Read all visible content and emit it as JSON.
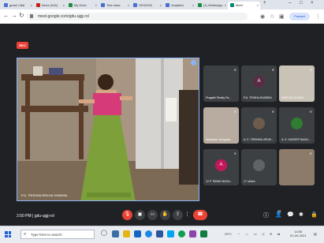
{
  "browser": {
    "tabs": [
      {
        "label": "gmail | Mai",
        "color": "#4a6fd3"
      },
      {
        "label": "Inbox (542)",
        "color": "#c5221f"
      },
      {
        "label": "My Drive",
        "color": "#1e8e3e"
      },
      {
        "label": "Test class",
        "color": "#4a6fd3"
      },
      {
        "label": "GE02004",
        "color": "#4a6fd3"
      },
      {
        "label": "Analytics",
        "color": "#4a6fd3"
      },
      {
        "label": "(1) WhatsApp",
        "color": "#1e8e3e"
      },
      {
        "label": "Meet",
        "color": "#00897b"
      }
    ],
    "new_tab": "+",
    "address": "meet.google.com/gdu-ujgj-rol",
    "paused_label": "Paused"
  },
  "meet": {
    "rec_label": "REC",
    "main_participant": "P.A. TRISHNA REKHA SHARMA",
    "tiles": [
      {
        "name": "Pragathi Reddy Pa...",
        "initial": "",
        "color": "#3c4043"
      },
      {
        "name": "P.A. TRISHA SHARMA",
        "initial": "A",
        "color": "#5b2b45"
      },
      {
        "name": "NASHITA SHAIKH",
        "initial": "",
        "color": "#c9c2b6"
      },
      {
        "name": "Maitreyee Sengupta",
        "initial": "",
        "color": "#b8aba0"
      },
      {
        "name": "A. E. TRISHNA VEDIK...",
        "initial": "",
        "color": "#3c4043"
      },
      {
        "name": "A. E. SUDEEP NAGA...",
        "initial": "",
        "color": "#3c4043"
      },
      {
        "name": "12 P. PAVAN NAGA...",
        "initial": "A",
        "color": "#c2185b"
      },
      {
        "name": "17 others",
        "initial": "",
        "color": "#3c4043"
      },
      {
        "name": "",
        "initial": "",
        "color": "#8c7a6b"
      }
    ],
    "time_meeting": "2:50 PM  |  gdu-ujgj-rol",
    "people_count": "25",
    "icons": {
      "mic": "mic-icon",
      "cam": "camera-icon",
      "cc": "captions-icon",
      "present": "present-icon",
      "hand": "raise-hand-icon",
      "more": "more-options-icon",
      "end": "end-call-icon"
    }
  },
  "taskbar": {
    "search_placeholder": "Type here to search",
    "temperature": "29°C",
    "clock_time": "14:50",
    "clock_date": "01-09-2021"
  }
}
